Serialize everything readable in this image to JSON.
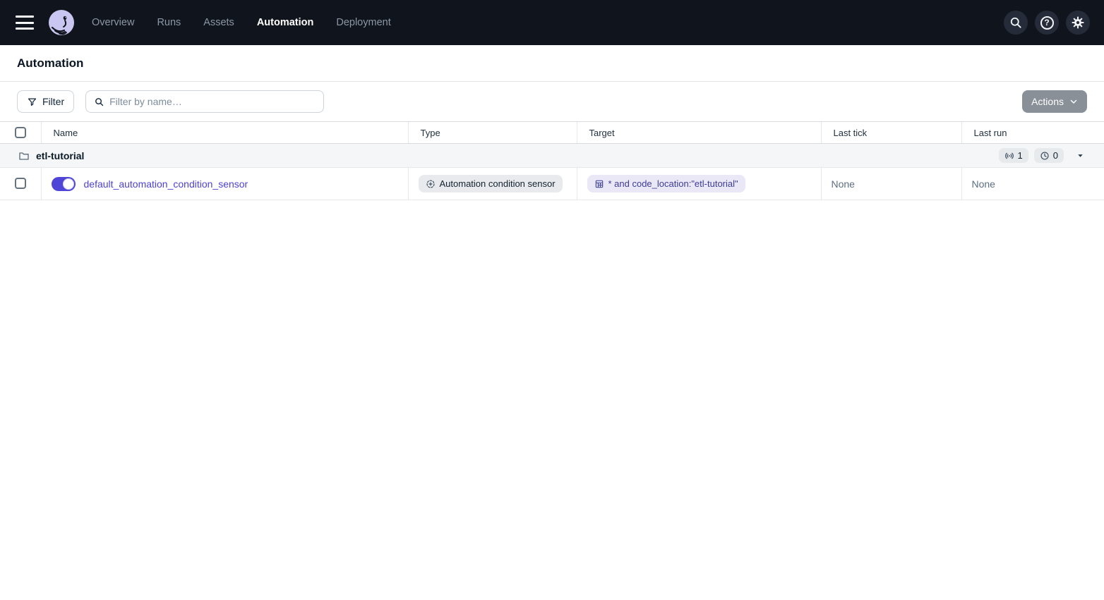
{
  "header": {
    "nav": [
      {
        "label": "Overview",
        "active": false
      },
      {
        "label": "Runs",
        "active": false
      },
      {
        "label": "Assets",
        "active": false
      },
      {
        "label": "Automation",
        "active": true
      },
      {
        "label": "Deployment",
        "active": false
      }
    ],
    "help_glyph": "?"
  },
  "page": {
    "title": "Automation"
  },
  "toolbar": {
    "filter_label": "Filter",
    "search_placeholder": "Filter by name…",
    "search_value": "",
    "actions_label": "Actions"
  },
  "table": {
    "columns": {
      "name": "Name",
      "type": "Type",
      "target": "Target",
      "last_tick": "Last tick",
      "last_run": "Last run"
    },
    "group_row": {
      "name": "etl-tutorial",
      "sensor_count": "1",
      "schedule_count": "0"
    },
    "rows": [
      {
        "name": "default_automation_condition_sensor",
        "toggle_on": true,
        "type_label": "Automation condition sensor",
        "target_label": "* and code_location:\"etl-tutorial\"",
        "last_tick": "None",
        "last_run": "None"
      }
    ]
  },
  "colors": {
    "header_bg": "#10151d",
    "accent_indigo": "#4f45d6",
    "link": "#4e42d4",
    "group_row_bg": "#f4f6f7",
    "badge_bg": "#e8eaed",
    "target_badge_bg": "#eae8f7",
    "target_badge_text": "#3d3c96",
    "actions_btn_bg": "#8a9097"
  }
}
